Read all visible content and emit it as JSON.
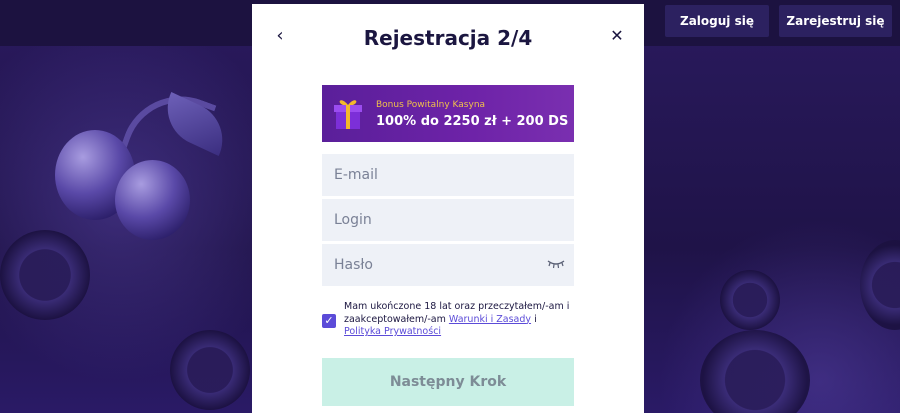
{
  "header": {
    "login_label": "Zaloguj się",
    "register_label": "Zarejestruj się"
  },
  "modal": {
    "title": "Rejestracja 2/4",
    "back_icon": "chevron-left-icon",
    "close_icon": "close-icon",
    "bonus": {
      "subtitle": "Bonus Powitalny Kasyna",
      "headline": "100% do 2250 zł + 200 DS",
      "icon": "gift-icon",
      "color_from": "#5a1f9a",
      "color_to": "#7a2fb0"
    },
    "fields": {
      "email_placeholder": "E-mail",
      "login_placeholder": "Login",
      "password_placeholder": "Hasło"
    },
    "terms": {
      "checked": true,
      "text_before": "Mam ukończone 18 lat oraz przeczytałem/-am i zaakceptowałem/-am",
      "link_terms": "Warunki i Zasady",
      "conjunction": "i",
      "link_privacy": "Polityka Prywatności"
    },
    "next_button": "Następny Krok"
  },
  "colors": {
    "accent": "#5b4bd8",
    "next_button_bg": "#c9f0e6",
    "background": "#231650"
  }
}
